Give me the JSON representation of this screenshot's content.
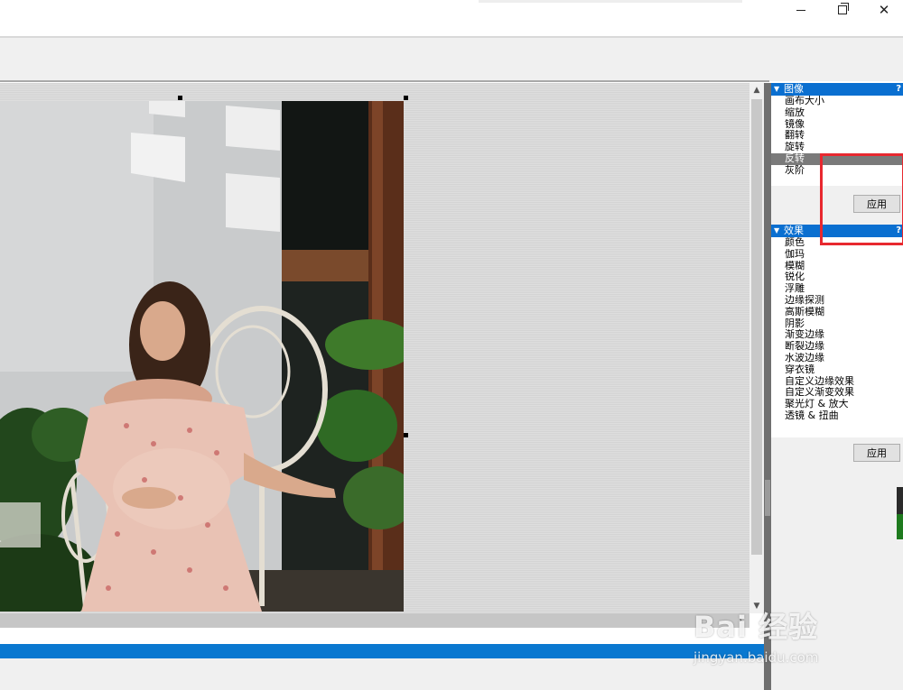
{
  "window": {
    "min_symbol": "—",
    "close_symbol": "✕"
  },
  "panel": {
    "image_section": {
      "title": "图像",
      "help": "?",
      "items": [
        "画布大小",
        "缩放",
        "镜像",
        "翻转",
        "旋转",
        "反转",
        "灰阶"
      ],
      "selected_index": 5,
      "apply_label": "应用"
    },
    "effects_section": {
      "title": "效果",
      "help": "?",
      "items": [
        "颜色",
        "伽玛",
        "模糊",
        "锐化",
        "浮雕",
        "边缘探测",
        "高斯模糊",
        "阴影",
        "渐变边缘",
        "断裂边缘",
        "水波边缘",
        "穿衣镜",
        "自定义边缘效果",
        "自定义渐变效果",
        "聚光灯 & 放大",
        "透镜 & 扭曲"
      ],
      "apply_label": "应用"
    }
  },
  "scroll": {
    "up_arrow": "▲",
    "down_arrow": "▼",
    "right_arrow": "›"
  },
  "watermark": {
    "brand": "Bai 经验",
    "url": "jingyan.baidu.com"
  },
  "colors": {
    "accent_blue": "#0a6fd0",
    "highlight_red": "#e8282f",
    "selection_gray": "#7a7a7a"
  }
}
